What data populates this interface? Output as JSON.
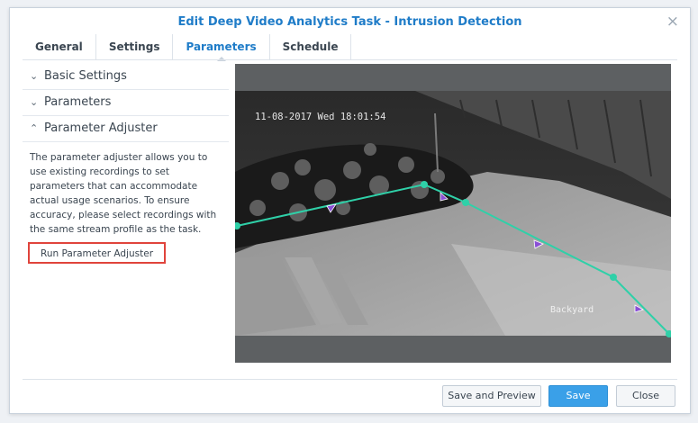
{
  "dialog": {
    "title": "Edit Deep Video Analytics Task - Intrusion Detection",
    "close_glyph": "×"
  },
  "tabs": [
    {
      "label": "General"
    },
    {
      "label": "Settings"
    },
    {
      "label": "Parameters"
    },
    {
      "label": "Schedule"
    }
  ],
  "active_tab": "Parameters",
  "sections": {
    "basic": {
      "label": "Basic Settings",
      "chevron": "⌄"
    },
    "params": {
      "label": "Parameters",
      "chevron": "⌄"
    },
    "adjuster": {
      "label": "Parameter Adjuster",
      "chevron": "⌃"
    }
  },
  "adjuster": {
    "description": "The parameter adjuster allows you to use existing recordings to set parameters that can accommodate actual usage scenarios. To ensure accuracy, please select recordings with the same stream profile as the task.",
    "button_label": "Run Parameter Adjuster"
  },
  "video": {
    "timestamp": "11-08-2017 Wed 18:01:54",
    "camera_name": "Backyard",
    "line_color": "#2fd0a8",
    "marker_color": "#8a4fd6"
  },
  "footer": {
    "save_preview_label": "Save and Preview",
    "save_label": "Save",
    "close_label": "Close"
  },
  "colors": {
    "title": "#1f7cc8",
    "primary": "#3aa0e8",
    "highlight": "#e0443c"
  }
}
